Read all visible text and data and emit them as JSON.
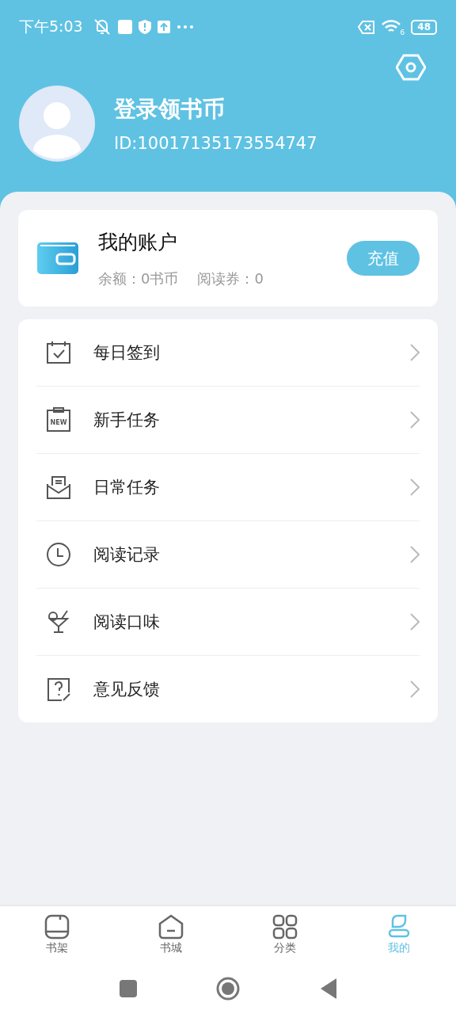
{
  "status_bar": {
    "time": "下午5:03",
    "wifi_badge": "6",
    "battery": "48"
  },
  "profile": {
    "name": "登录领书币",
    "id": "ID:10017135173554747"
  },
  "account": {
    "title": "我的账户",
    "balance": "余额：0书币",
    "vouchers": "阅读券：0",
    "button": "充值"
  },
  "menu": [
    {
      "kind": "calendar",
      "label": "每日签到"
    },
    {
      "kind": "new",
      "badge": "NEW",
      "label": "新手任务"
    },
    {
      "kind": "mail",
      "label": "日常任务"
    },
    {
      "kind": "clock",
      "label": "阅读记录"
    },
    {
      "kind": "drink",
      "label": "阅读口味"
    },
    {
      "kind": "feedback",
      "label": "意见反馈"
    }
  ],
  "tabs": [
    {
      "kind": "shelf",
      "label": "书架",
      "selected": false
    },
    {
      "kind": "store",
      "label": "书城",
      "selected": false
    },
    {
      "kind": "grid",
      "label": "分类",
      "selected": false
    },
    {
      "kind": "user",
      "label": "我的",
      "selected": true
    }
  ]
}
